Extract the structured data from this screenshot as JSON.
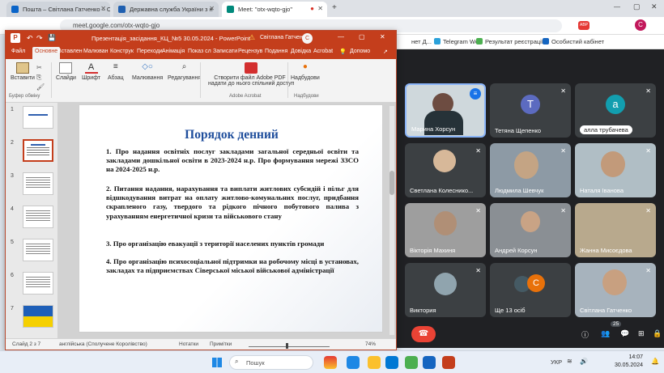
{
  "browser": {
    "tabs": [
      {
        "title": "Пошта – Світлана Гатченко – Ou"
      },
      {
        "title": "Державна служба України з н"
      },
      {
        "title": "Meet: \"otx-wqto-gjo\""
      }
    ],
    "url": "meet.google.com/otx-wqto-gjo",
    "bookmarks": [
      "Telegram Web",
      "Результат реєстрації",
      "Особистий кабінет"
    ],
    "bookmarks_prefix": "нет Д..."
  },
  "powerpoint": {
    "title": "Презентація_засідання_КЦ_№5 30.05.2024  -  PowerPoint",
    "user": "Світлана Гатченко",
    "warning_icon": "warning-icon",
    "ribbon_tabs": [
      "Файл",
      "Основне",
      "Вставлен",
      "Малюван",
      "Конструк",
      "Переходи",
      "Анімація",
      "Показ сл",
      "Записати",
      "Рецензув",
      "Подання",
      "Довідка",
      "Acrobat"
    ],
    "help_search": "Допомо",
    "groups": {
      "paste": "Вставити",
      "clipboard": "Буфер обміну",
      "slides": "Слайди",
      "font": "Шрифт",
      "paragraph": "Абзац",
      "drawing": "Малювання",
      "editing": "Редагування",
      "adobe_line1": "Створити файл Adobe PDF і",
      "adobe_line2": "надати до нього спільний доступ",
      "adobe_group": "Adobe Acrobat",
      "addins": "Надбудови",
      "addins_group": "Надбудови"
    },
    "slide_numbers": [
      "1",
      "2",
      "3",
      "4",
      "5",
      "6",
      "7"
    ],
    "slide": {
      "title": "Порядок денний",
      "items": [
        "1.  Про надання освітніх послуг закладами загальної середньої освіти та закладами дошкільної освіти в 2023-2024 н.р. Про формування мережі ЗЗСО на 2024-2025 н.р.",
        "2.  Питання надання, нарахування та виплати житлових субсидій і пільг для відшкодування витрат на оплату житлово-комунальних послуг, придбання скрапленого газу, твердого та рідкого пічного побутового палива з урахуванням енергетичної кризи та військового стану",
        "3.  Про організацію евакуації з території населених пунктів громади",
        "4.  Про організацію психосоціальної підтримки на робочому місці в установах, закладах та підприємствах Сіверської міської військової адміністрації"
      ]
    },
    "status": {
      "slide": "Слайд 2 з 7",
      "language": "англійська (Сполучене Королівство)",
      "notes": "Нотатки",
      "comments": "Примітки",
      "zoom": "74%"
    }
  },
  "meet": {
    "participants": [
      {
        "name": "Марина Хорсун",
        "speaking": true
      },
      {
        "name": "Тетяна Щепенко",
        "initial": "Т",
        "color": "#5c6bc0"
      },
      {
        "name": "алла трубачева",
        "initial": "а",
        "color": "#129eaf"
      },
      {
        "name": "Светлана Колеснико..."
      },
      {
        "name": "Людмила Шевчук"
      },
      {
        "name": "Наталя Іванова"
      },
      {
        "name": "Вікторія Махиня"
      },
      {
        "name": "Андрей Корсун"
      },
      {
        "name": "Жанна Мисоєдова"
      },
      {
        "name": "Виктория"
      },
      {
        "name": "Ще 13 осіб",
        "initial": "С",
        "color": "#e8710a"
      },
      {
        "name": "Світлана Гатченко"
      }
    ],
    "participant_count": "25"
  },
  "taskbar": {
    "search": "Пошук",
    "lang": "УКР",
    "time": "14:07",
    "date": "30.05.2024"
  },
  "colors": {
    "ppt_accent": "#c43e1c",
    "meet_bg": "#202124",
    "slide_title": "#1f4e9c"
  }
}
